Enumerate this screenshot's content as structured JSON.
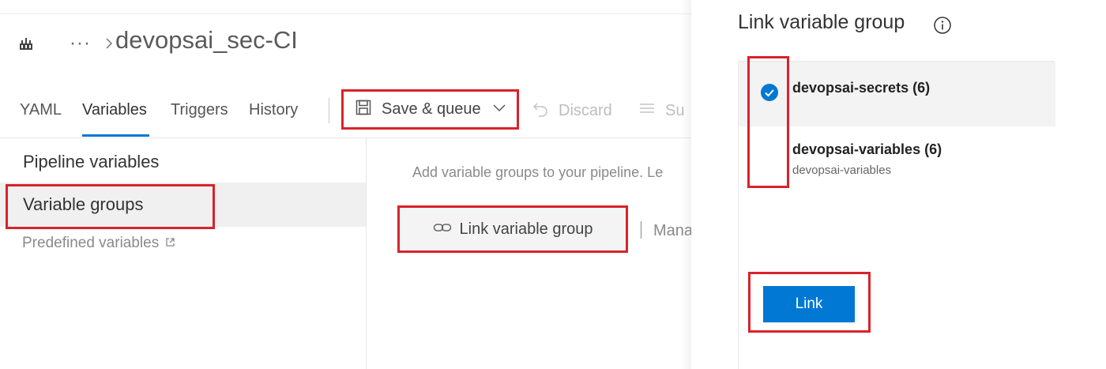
{
  "header": {
    "more_label": "···",
    "pipeline_title": "devopsai_sec-CI"
  },
  "tabs": [
    {
      "label": "YAML"
    },
    {
      "label": "Variables",
      "selected": true
    },
    {
      "label": "Triggers"
    },
    {
      "label": "History"
    }
  ],
  "toolbar": {
    "save_queue_label": "Save & queue",
    "discard_label": "Discard",
    "summary_label": "Su"
  },
  "left_nav": {
    "pipeline_variables": "Pipeline variables",
    "variable_groups": "Variable groups",
    "predefined_variables": "Predefined variables"
  },
  "content": {
    "add_text": "Add variable groups to your pipeline. Le",
    "link_button_label": "Link variable group",
    "manage_text": "Mana"
  },
  "panel": {
    "title": "Link variable group",
    "items": [
      {
        "title": "devopsai-secrets (6)",
        "subtitle": "",
        "selected": true
      },
      {
        "title": "devopsai-variables (6)",
        "subtitle": "devopsai-variables",
        "selected": false
      }
    ],
    "link_button_label": "Link"
  },
  "colors": {
    "accent": "#0078d4",
    "highlight_box": "#d8232a",
    "selected_row": "#f3f3f3"
  },
  "icons": {
    "pipeline": "pipeline-icon",
    "save": "floppy-disk-icon",
    "discard": "undo-icon",
    "summary": "list-icon",
    "link": "chain-link-icon",
    "external": "external-link-icon",
    "info": "info-icon",
    "check": "check-circle-icon"
  }
}
